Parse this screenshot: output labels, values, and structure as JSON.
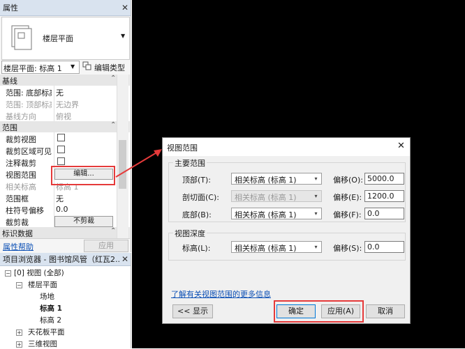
{
  "properties_panel": {
    "title": "属性",
    "type_name": "楼层平面",
    "instance_selector": "楼层平面: 标高 1",
    "edit_type": "编辑类型",
    "groups": {
      "baseline": "基线",
      "extents": "范围",
      "identity": "标识数据"
    },
    "rows": {
      "range_base": {
        "label": "范围: 底部标高",
        "value": "无"
      },
      "range_top": {
        "label": "范围: 顶部标高",
        "value": "无边界"
      },
      "baseline_dir": {
        "label": "基线方向",
        "value": "俯视"
      },
      "crop_view": {
        "label": "裁剪视图"
      },
      "crop_visible": {
        "label": "裁剪区域可见"
      },
      "annot_crop": {
        "label": "注释裁剪"
      },
      "view_range": {
        "label": "视图范围",
        "button": "编辑..."
      },
      "assoc_level": {
        "label": "相关标高",
        "value": "标高 1"
      },
      "scope_box": {
        "label": "范围框",
        "value": "无"
      },
      "column_offset": {
        "label": "柱符号偏移",
        "value": "0.0"
      },
      "depth_clip": {
        "label": "截剪裁",
        "button": "不剪裁"
      }
    },
    "help_link": "属性帮助",
    "apply": "应用"
  },
  "project_browser": {
    "title": "项目浏览器 - 图书馆风管（红瓦2...",
    "items": {
      "views_all": "视图 (全部)",
      "floor_plans": "楼层平面",
      "site": "场地",
      "level1": "标高 1",
      "level2": "标高 2",
      "ceiling_plans": "天花板平面",
      "three_d": "三维视图"
    }
  },
  "dialog": {
    "title": "视图范围",
    "primary_range": "主要范围",
    "rows": {
      "top": {
        "label": "顶部(T):",
        "combo": "相关标高 (标高 1)",
        "offset_label": "偏移(O):",
        "offset": "5000.0"
      },
      "cut": {
        "label": "剖切面(C):",
        "combo": "相关标高 (标高 1)",
        "offset_label": "偏移(E):",
        "offset": "1200.0"
      },
      "bottom": {
        "label": "底部(B):",
        "combo": "相关标高 (标高 1)",
        "offset_label": "偏移(F):",
        "offset": "0.0"
      }
    },
    "view_depth": "视图深度",
    "level": {
      "label": "标高(L):",
      "combo": "相关标高 (标高 1)",
      "offset_label": "偏移(S):",
      "offset": "0.0"
    },
    "more_info": "了解有关视图范围的更多信息",
    "show_button": "<< 显示",
    "ok": "确定",
    "apply": "应用(A)",
    "cancel": "取消"
  },
  "colors": {
    "annotation_red": "#e53a3a",
    "canvas": "#000000",
    "link_blue": "#0b4fb5"
  }
}
